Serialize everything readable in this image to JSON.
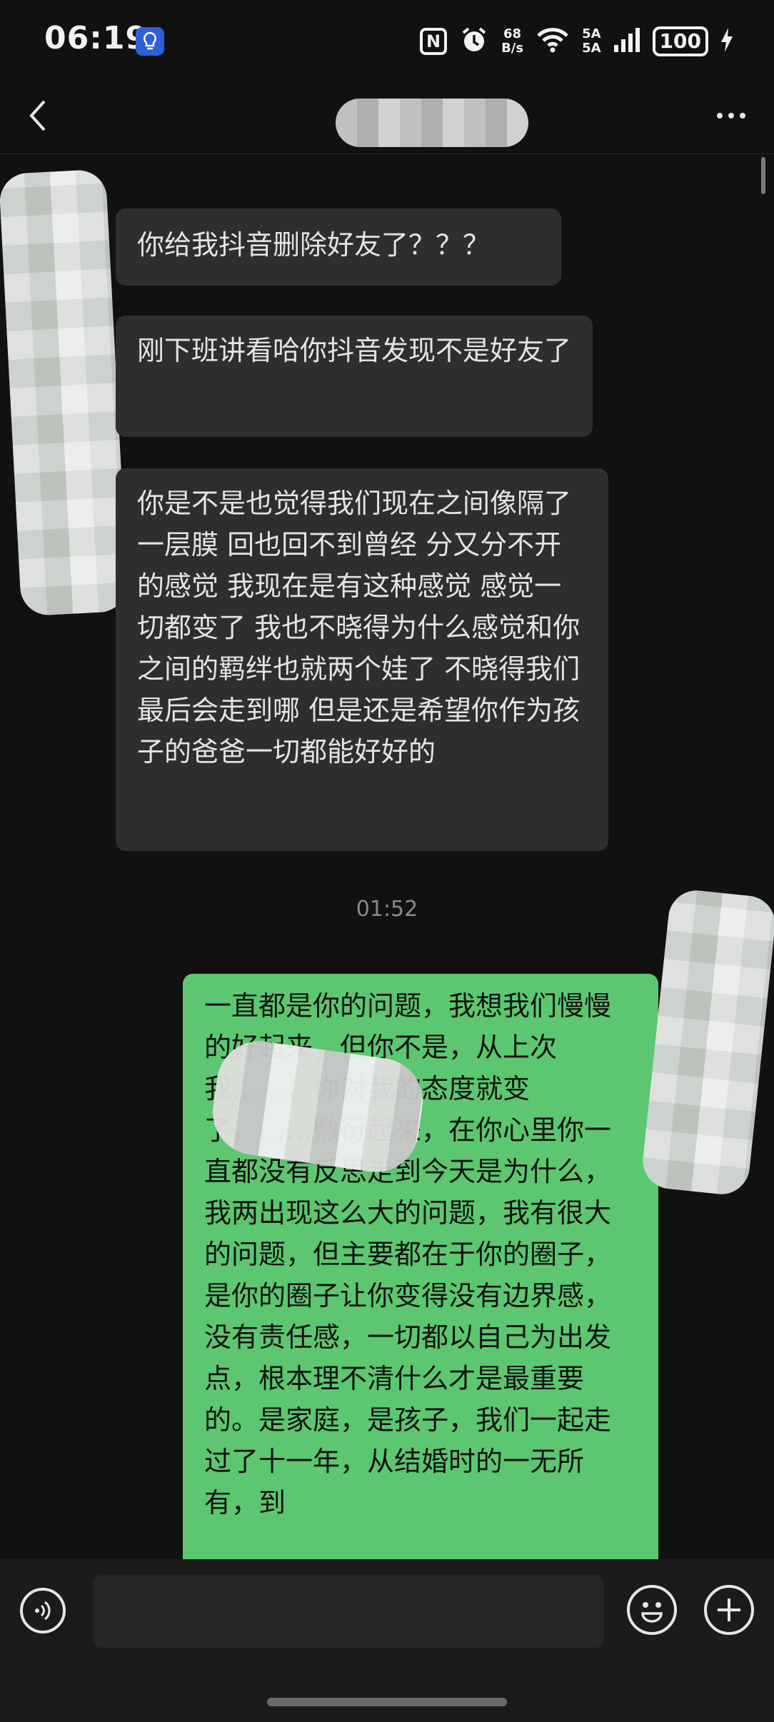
{
  "status_bar": {
    "time": "06:19",
    "nfc": "N",
    "net_speed_top": "68",
    "net_speed_bottom": "B/s",
    "signal_top": "5A",
    "signal_bottom": "5A",
    "battery": "100"
  },
  "header": {
    "contact_name": ""
  },
  "messages": [
    {
      "direction": "incoming",
      "text": "你给我抖音删除好友了？？？"
    },
    {
      "direction": "incoming",
      "text": "刚下班讲看哈你抖音发现不是好友了"
    },
    {
      "direction": "incoming",
      "text": "你是不是也觉得我们现在之间像隔了一层膜 回也回不到曾经 分又分不开的感觉 我现在是有这种感觉 感觉一切都变了 我也不晓得为什么感觉和你之间的羁绊也就两个娃了 不晓得我们最后会走到哪 但是还是希望你作为孩子的爸爸一切都能好好的"
    },
    {
      "direction": "outgoing",
      "text": "一直都是你的问题，我想我们慢慢的好起来，但你不是，从上次我……，你对我的态度就变了，……敷衍起来，在你心里你一直都没有反思走到今天是为什么，我两出现这么大的问题，我有很大的问题，但主要都在于你的圈子，是你的圈子让你变得没有边界感，没有责任感，一切都以自己为出发点，根本理不清什么才是最重要的。是家庭，是孩子，我们一起走过了十一年，从结婚时的一无所有，到"
    }
  ],
  "timestamp": "01:52",
  "input": {
    "placeholder": ""
  },
  "icons": {
    "back": "chevron-left-icon",
    "more": "more-dots-icon",
    "voice": "voice-icon",
    "emoji": "emoji-icon",
    "plus": "plus-icon"
  },
  "colors": {
    "background": "#111111",
    "incoming_bubble": "#2e2e2e",
    "outgoing_bubble": "#5cc770",
    "app_icon": "#2f5fd6"
  }
}
